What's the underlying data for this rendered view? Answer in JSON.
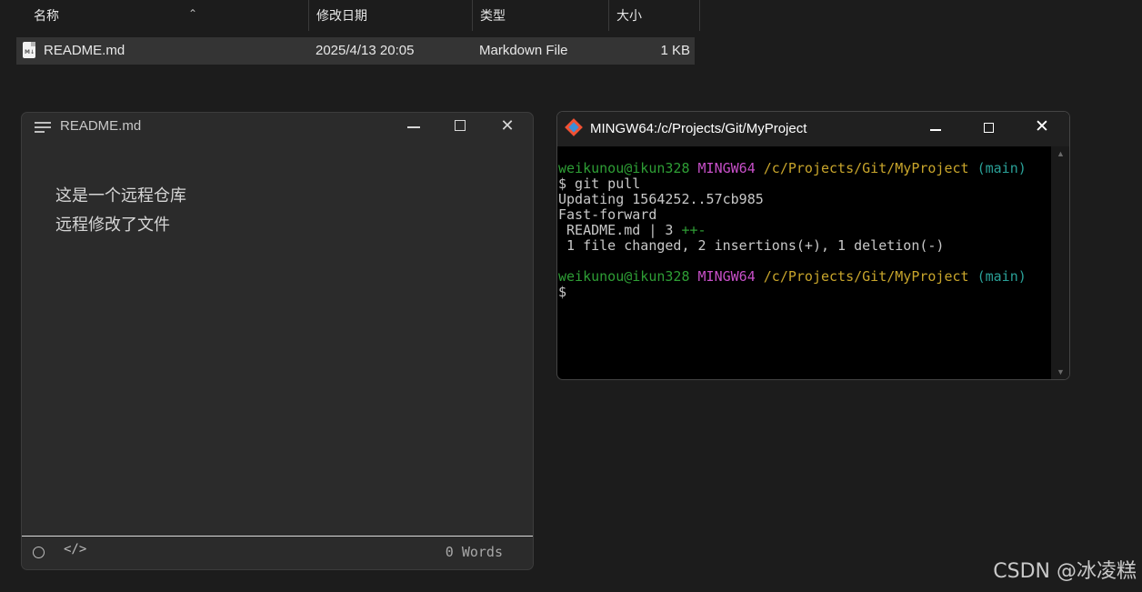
{
  "explorer": {
    "columns": [
      "名称",
      "修改日期",
      "类型",
      "大小"
    ],
    "files": [
      {
        "name": "README.md",
        "modified": "2025/4/13 20:05",
        "type": "Markdown File",
        "size": "1 KB"
      }
    ]
  },
  "notepad": {
    "title": "README.md",
    "lines": [
      "这是一个远程仓库",
      "远程修改了文件"
    ],
    "word_count": "0 Words"
  },
  "terminal": {
    "title": "MINGW64:/c/Projects/Git/MyProject",
    "prompt_user": "weikunou@ikun328",
    "prompt_env": "MINGW64",
    "prompt_path": "/c/Projects/Git/MyProject",
    "prompt_branch": "(main)",
    "command": "$ git pull",
    "output": [
      "Updating 1564252..57cb985",
      "Fast-forward"
    ],
    "diff_file": " README.md | 3 ",
    "diff_marks": "++-",
    "summary": " 1 file changed, 2 insertions(+), 1 deletion(-)",
    "final_prompt": "$"
  },
  "watermark": "CSDN @冰凌糕"
}
